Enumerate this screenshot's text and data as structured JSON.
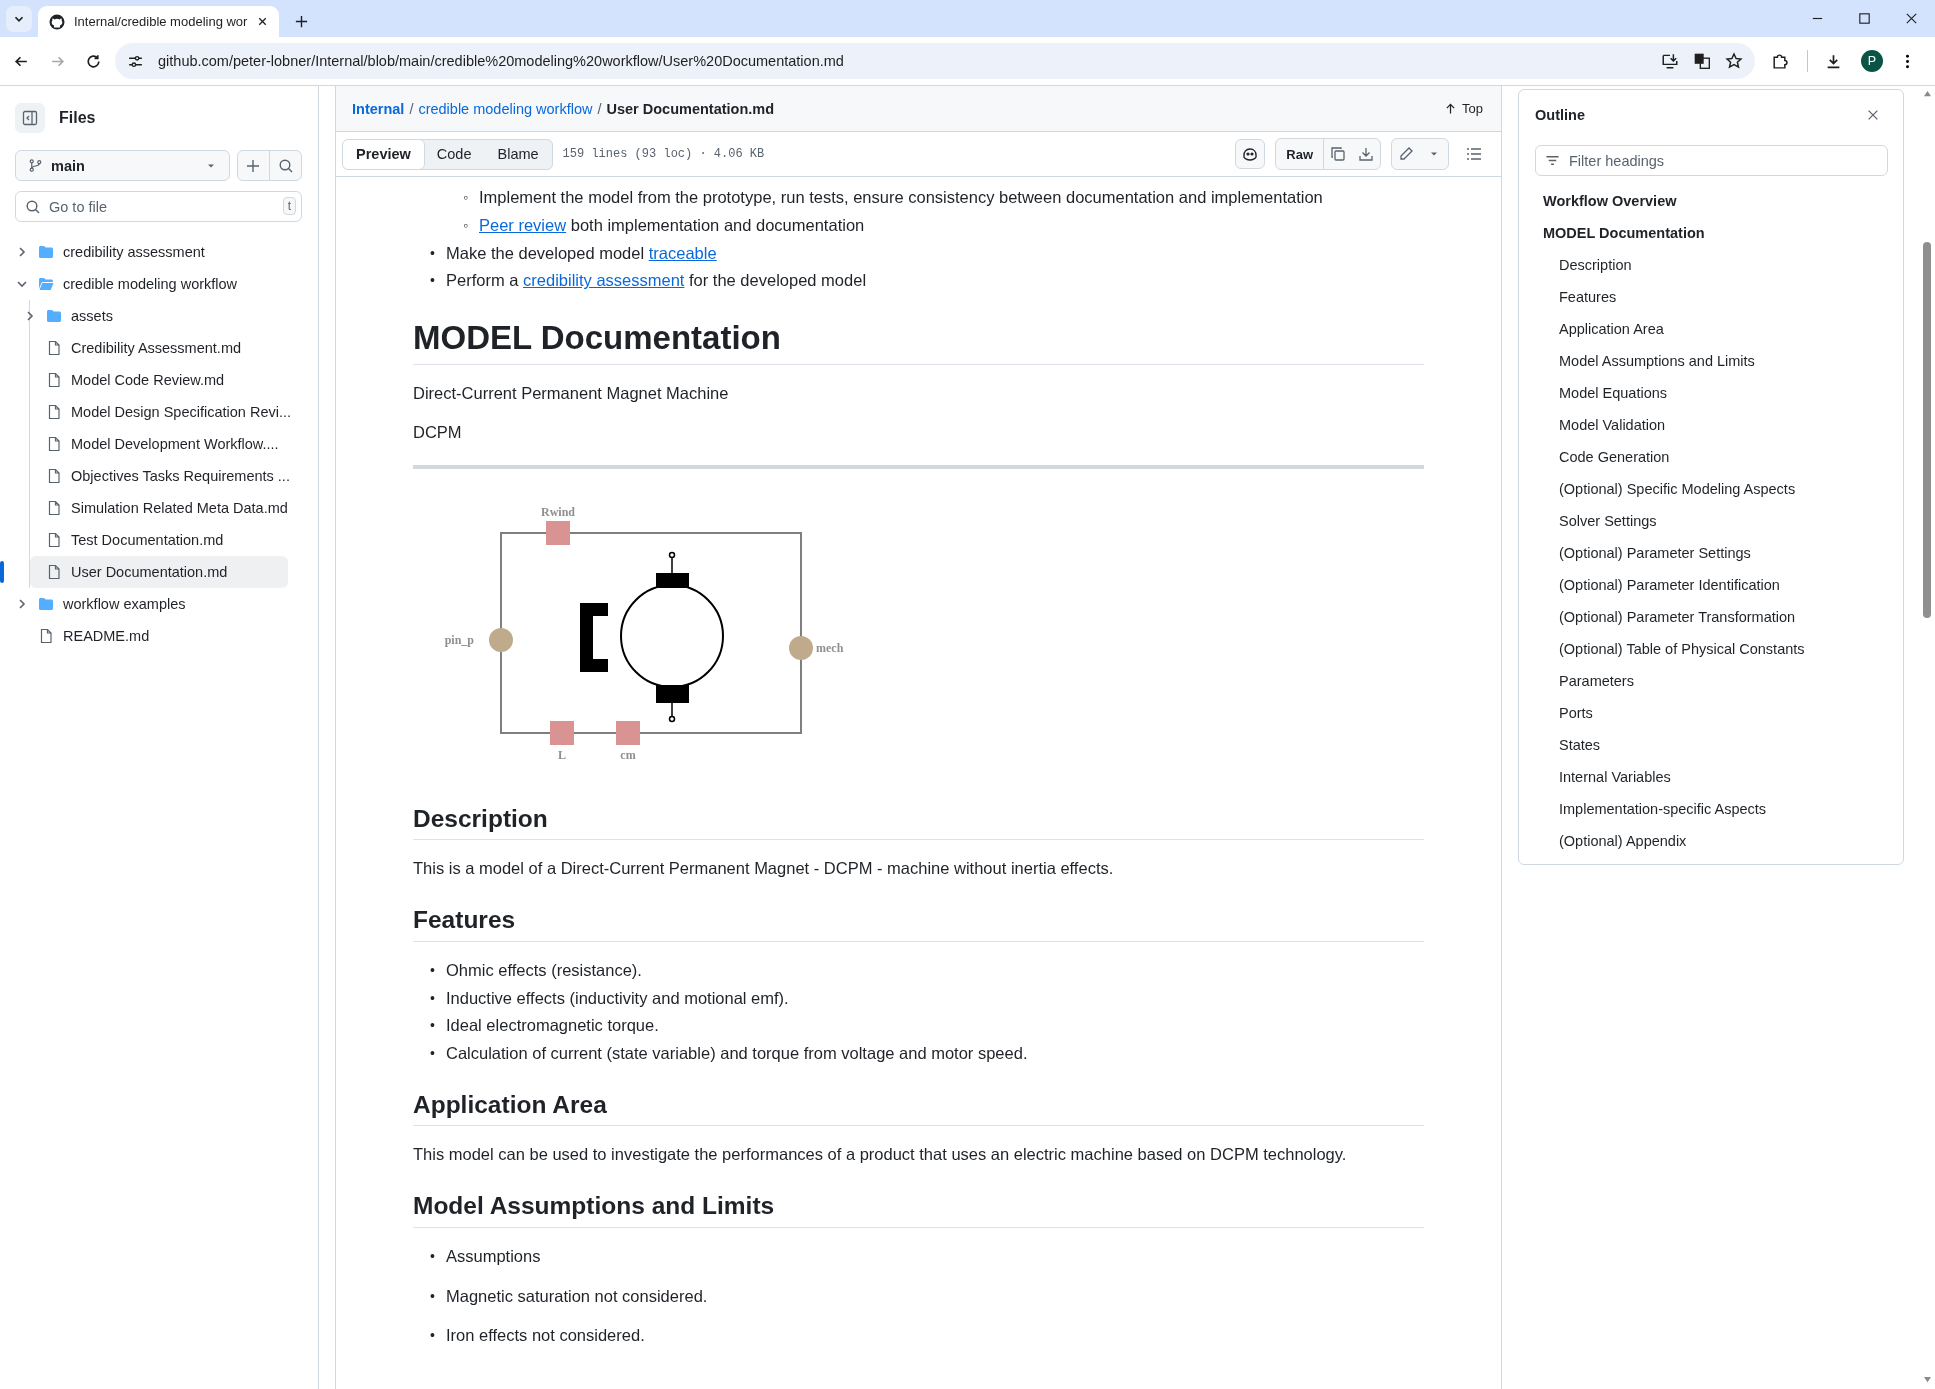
{
  "browser": {
    "tab": {
      "title": "Internal/credible modeling wor"
    },
    "url": "github.com/peter-lobner/Internal/blob/main/credible%20modeling%20workflow/User%20Documentation.md",
    "profile": "P"
  },
  "sidebar": {
    "title": "Files",
    "branch": "main",
    "search": {
      "placeholder": "Go to file",
      "shortcut": "t"
    },
    "tree": [
      {
        "kind": "folder",
        "label": "credibility assessment",
        "expanded": false,
        "selected": false
      },
      {
        "kind": "folder",
        "label": "credible modeling workflow",
        "expanded": true,
        "selected": false,
        "children": [
          {
            "kind": "folder",
            "label": "assets",
            "expanded": false,
            "selected": false
          },
          {
            "kind": "file",
            "label": "Credibility Assessment.md",
            "selected": false
          },
          {
            "kind": "file",
            "label": "Model Code Review.md",
            "selected": false
          },
          {
            "kind": "file",
            "label": "Model Design Specification Revi...",
            "selected": false
          },
          {
            "kind": "file",
            "label": "Model Development Workflow....",
            "selected": false
          },
          {
            "kind": "file",
            "label": "Objectives Tasks Requirements ...",
            "selected": false
          },
          {
            "kind": "file",
            "label": "Simulation Related Meta Data.md",
            "selected": false
          },
          {
            "kind": "file",
            "label": "Test Documentation.md",
            "selected": false
          },
          {
            "kind": "file",
            "label": "User Documentation.md",
            "selected": true
          }
        ]
      },
      {
        "kind": "folder",
        "label": "workflow examples",
        "expanded": false,
        "selected": false
      },
      {
        "kind": "file",
        "label": "README.md",
        "selected": false
      }
    ]
  },
  "file_header": {
    "breadcrumb": [
      {
        "text": "Internal",
        "kind": "repo"
      },
      {
        "text": "/",
        "kind": "sep"
      },
      {
        "text": "credible modeling workflow",
        "kind": "link"
      },
      {
        "text": "/",
        "kind": "sep"
      },
      {
        "text": "User Documentation.md",
        "kind": "current"
      }
    ],
    "top_button": "Top"
  },
  "toolbar": {
    "tabs": [
      {
        "label": "Preview",
        "selected": true
      },
      {
        "label": "Code",
        "selected": false
      },
      {
        "label": "Blame",
        "selected": false
      }
    ],
    "file_info": "159 lines (93 loc) · 4.06 KB",
    "raw_button": "Raw"
  },
  "document": {
    "blocks": [
      {
        "kind": "list",
        "items": [
          {
            "children": [
              {
                "marker": "◦",
                "parts": [
                  {
                    "text": "Implement the model from the prototype, run tests, ensure consistency between documentation and implementation"
                  }
                ]
              },
              {
                "marker": "◦",
                "parts": [
                  {
                    "text": "Peer review",
                    "link": true
                  },
                  {
                    "text": " both implementation and documentation"
                  }
                ]
              }
            ]
          },
          {
            "marker": "•",
            "parts": [
              {
                "text": "Make the developed model "
              },
              {
                "text": "traceable",
                "link": true
              }
            ]
          },
          {
            "marker": "•",
            "parts": [
              {
                "text": "Perform a "
              },
              {
                "text": "credibility assessment",
                "link": true
              },
              {
                "text": " for the developed model"
              }
            ]
          }
        ]
      },
      {
        "kind": "h1",
        "text": "MODEL Documentation"
      },
      {
        "kind": "p",
        "text": "Direct-Current Permanent Magnet Machine"
      },
      {
        "kind": "p",
        "text": "DCPM"
      },
      {
        "kind": "hr"
      },
      {
        "kind": "diagram",
        "ports": [
          {
            "label": "Rwind",
            "kind": "square"
          },
          {
            "label": "pin_p",
            "kind": "circle"
          },
          {
            "label": "mech",
            "kind": "circle"
          },
          {
            "label": "L",
            "kind": "square"
          },
          {
            "label": "cm",
            "kind": "square"
          }
        ]
      },
      {
        "kind": "h2",
        "text": "Description"
      },
      {
        "kind": "p",
        "text": "This is a model of a Direct-Current Permanent Magnet - DCPM - machine without inertia effects."
      },
      {
        "kind": "h2",
        "text": "Features"
      },
      {
        "kind": "list",
        "items": [
          {
            "marker": "•",
            "parts": [
              {
                "text": "Ohmic effects (resistance)."
              }
            ]
          },
          {
            "marker": "•",
            "parts": [
              {
                "text": "Inductive effects (inductivity and motional emf)."
              }
            ]
          },
          {
            "marker": "•",
            "parts": [
              {
                "text": "Ideal electromagnetic torque."
              }
            ]
          },
          {
            "marker": "•",
            "parts": [
              {
                "text": "Calculation of current (state variable) and torque from voltage and motor speed."
              }
            ]
          }
        ]
      },
      {
        "kind": "h2",
        "text": "Application Area"
      },
      {
        "kind": "p",
        "text": "This model can be used to investigate the performances of a product that uses an electric machine based on DCPM technology."
      },
      {
        "kind": "h2",
        "text": "Model Assumptions and Limits"
      },
      {
        "kind": "loose_list",
        "items": [
          {
            "marker": "•",
            "parts": [
              {
                "text": "Assumptions"
              }
            ]
          },
          {
            "marker": "•",
            "parts": [
              {
                "text": "Magnetic saturation not considered."
              }
            ]
          },
          {
            "marker": "•",
            "parts": [
              {
                "text": "Iron effects not considered."
              }
            ]
          }
        ]
      }
    ]
  },
  "outline": {
    "title": "Outline",
    "filter": {
      "placeholder": "Filter headings"
    },
    "items": [
      {
        "label": "Workflow Overview"
      },
      {
        "label": "MODEL Documentation",
        "children": [
          {
            "label": "Description"
          },
          {
            "label": "Features"
          },
          {
            "label": "Application Area"
          },
          {
            "label": "Model Assumptions and Limits"
          },
          {
            "label": "Model Equations"
          },
          {
            "label": "Model Validation"
          },
          {
            "label": "Code Generation"
          },
          {
            "label": "(Optional) Specific Modeling Aspects"
          },
          {
            "label": "Solver Settings"
          },
          {
            "label": "(Optional) Parameter Settings"
          },
          {
            "label": "(Optional) Parameter Identification"
          },
          {
            "label": "(Optional) Parameter Transformation"
          },
          {
            "label": "(Optional) Table of Physical Constants"
          },
          {
            "label": "Parameters"
          },
          {
            "label": "Ports"
          },
          {
            "label": "States"
          },
          {
            "label": "Internal Variables"
          },
          {
            "label": "Implementation-specific Aspects"
          },
          {
            "label": "(Optional) Appendix"
          }
        ]
      }
    ]
  }
}
